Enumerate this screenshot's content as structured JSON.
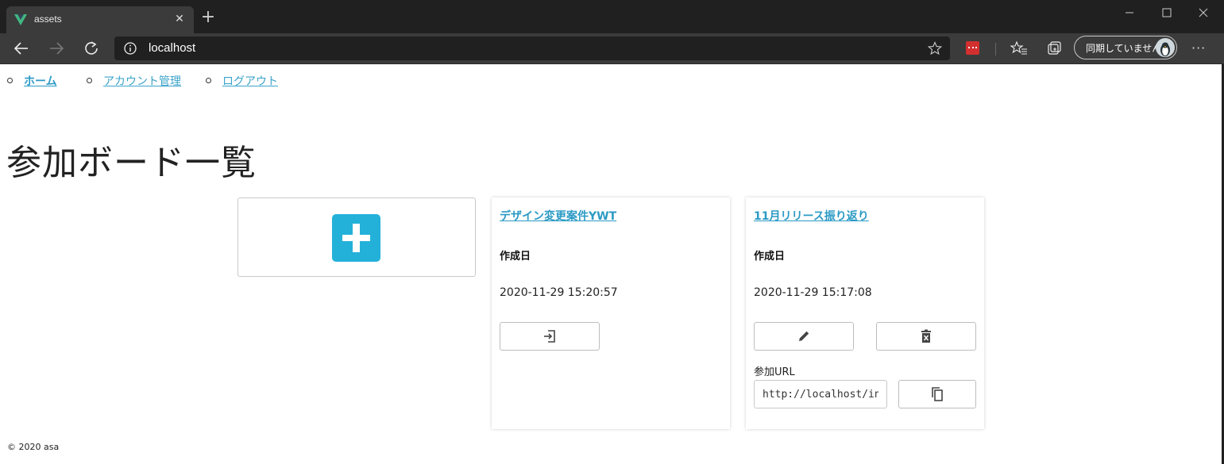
{
  "browser": {
    "tab_title": "assets",
    "url": "localhost",
    "profile_label": "同期していません",
    "colors": {
      "frame": "#202020",
      "toolbar": "#3b3b3b"
    },
    "icons": [
      "vue-favicon-icon",
      "close-icon",
      "plus-icon",
      "minimize-icon",
      "maximize-icon",
      "close-window-icon",
      "back-icon",
      "forward-icon",
      "refresh-icon",
      "info-icon",
      "star-icon",
      "extension-icon",
      "favorites-icon",
      "collections-icon",
      "avatar",
      "more-icon"
    ]
  },
  "nav": {
    "items": [
      {
        "label": "ホーム",
        "active": true
      },
      {
        "label": "アカウント管理",
        "active": false
      },
      {
        "label": "ログアウト",
        "active": false
      }
    ]
  },
  "page": {
    "title": "参加ボード一覧",
    "accent": "#23b1d9",
    "link_color": "#2b9ac4"
  },
  "boards": [
    {
      "title": "デザイン変更案件YWT",
      "created_label": "作成日",
      "created_at": "2020-11-29 15:20:57",
      "actions": [
        "enter-icon"
      ]
    },
    {
      "title": "11月リリース振り返り",
      "created_label": "作成日",
      "created_at": "2020-11-29 15:17:08",
      "actions": [
        "edit-icon",
        "delete-icon"
      ],
      "url_label": "参加URL",
      "url_value": "http://localhost/invi",
      "copy_icon": "copy-icon"
    }
  ],
  "footer": {
    "text": "© 2020 asa"
  }
}
